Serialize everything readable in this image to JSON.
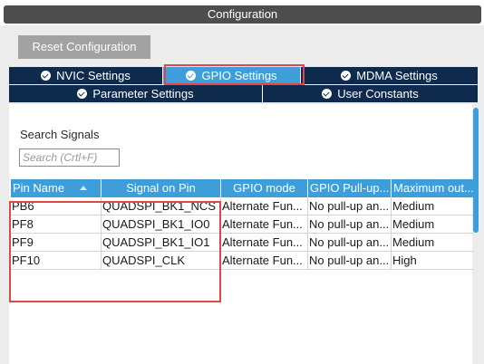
{
  "window": {
    "title": "Configuration"
  },
  "toolbar": {
    "reset_label": "Reset Configuration"
  },
  "tabs": [
    {
      "label": "NVIC Settings",
      "active": false
    },
    {
      "label": "GPIO Settings",
      "active": true
    },
    {
      "label": "MDMA Settings",
      "active": false
    },
    {
      "label": "Parameter Settings",
      "active": false
    },
    {
      "label": "User Constants",
      "active": false
    }
  ],
  "search": {
    "label": "Search Signals",
    "placeholder": "Search (Crtl+F)"
  },
  "table": {
    "headers": [
      "Pin Name",
      "Signal on Pin",
      "GPIO mode",
      "GPIO Pull-up...",
      "Maximum out..."
    ],
    "rows": [
      [
        "PB6",
        "QUADSPI_BK1_NCS",
        "Alternate Fun...",
        "No pull-up an...",
        "Medium"
      ],
      [
        "PF8",
        "QUADSPI_BK1_IO0",
        "Alternate Fun...",
        "No pull-up an...",
        "Medium"
      ],
      [
        "PF9",
        "QUADSPI_BK1_IO1",
        "Alternate Fun...",
        "No pull-up an...",
        "Medium"
      ],
      [
        "PF10",
        "QUADSPI_CLK",
        "Alternate Fun...",
        "No pull-up an...",
        "High"
      ]
    ]
  },
  "colors": {
    "accent": "#3d9ed9",
    "tab_dark": "#0e2a4c",
    "highlight": "#e04848",
    "title_bg": "#4d4d4f"
  }
}
